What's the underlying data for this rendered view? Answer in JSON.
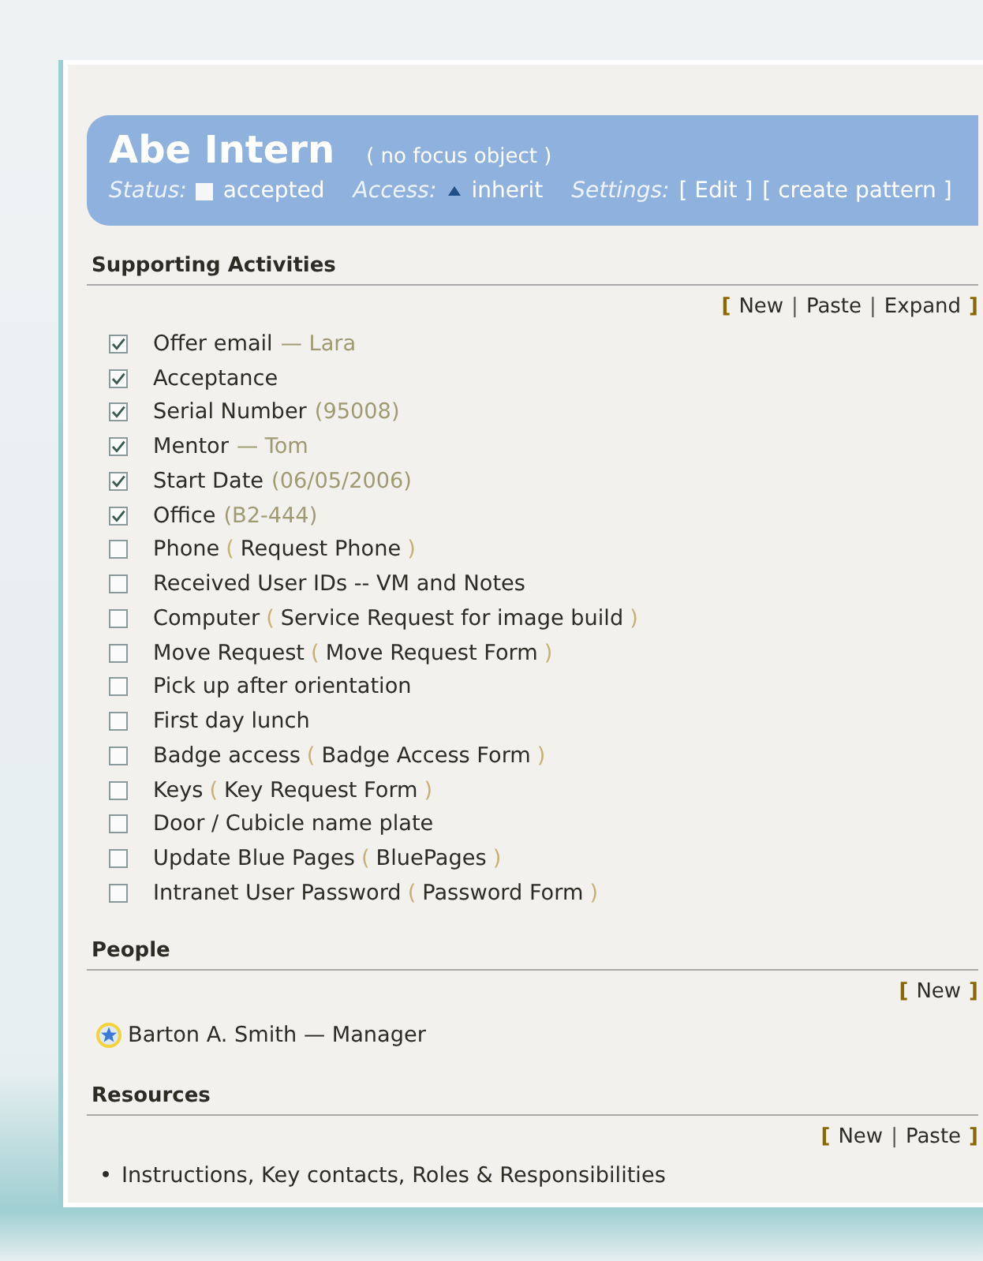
{
  "header": {
    "title": "Abe Intern",
    "focus": "( no focus object )",
    "status_label": "Status:",
    "status_value": "accepted",
    "access_label": "Access:",
    "access_value": "inherit",
    "settings_label": "Settings:",
    "settings_links": [
      "[ Edit ]",
      "[ create pattern ]"
    ]
  },
  "sections": [
    {
      "title": "Supporting Activities",
      "kind": "checklist",
      "actions": {
        "open": "[",
        "close": "]",
        "separator": "|",
        "items": [
          "New",
          "Paste",
          "Expand"
        ]
      },
      "items": [
        {
          "label": "Offer email",
          "checked": true,
          "kind": "person",
          "dash": "—",
          "detail": "Lara"
        },
        {
          "label": "Acceptance",
          "checked": true
        },
        {
          "label": "Serial Number",
          "checked": true,
          "kind": "value",
          "detail": "(95008)"
        },
        {
          "label": "Mentor",
          "checked": true,
          "kind": "person",
          "dash": "—",
          "detail": "Tom"
        },
        {
          "label": "Start Date",
          "checked": true,
          "kind": "value",
          "detail": "(06/05/2006)"
        },
        {
          "label": "Office",
          "checked": true,
          "kind": "value",
          "detail": "(B2-444)"
        },
        {
          "label": "Phone",
          "checked": false,
          "kind": "form",
          "open": "(",
          "detail": "Request Phone",
          "close": ")"
        },
        {
          "label": "Received User IDs -- VM and Notes",
          "checked": false
        },
        {
          "label": "Computer",
          "checked": false,
          "kind": "form",
          "open": "(",
          "detail": "Service Request for image build",
          "close": ")"
        },
        {
          "label": "Move Request",
          "checked": false,
          "kind": "form",
          "open": "(",
          "detail": "Move Request Form",
          "close": ")"
        },
        {
          "label": "Pick up after orientation",
          "checked": false
        },
        {
          "label": "First day lunch",
          "checked": false
        },
        {
          "label": "Badge access",
          "checked": false,
          "kind": "form",
          "open": "(",
          "detail": "Badge Access Form",
          "close": ")"
        },
        {
          "label": "Keys",
          "checked": false,
          "kind": "form",
          "open": "(",
          "detail": "Key Request Form",
          "close": ")"
        },
        {
          "label": "Door / Cubicle name plate",
          "checked": false
        },
        {
          "label": "Update Blue Pages",
          "checked": false,
          "kind": "form",
          "open": "(",
          "detail": "BluePages",
          "close": ")"
        },
        {
          "label": "Intranet User Password",
          "checked": false,
          "kind": "form",
          "open": "(",
          "detail": "Password Form",
          "close": ")"
        }
      ]
    },
    {
      "title": "People",
      "kind": "people",
      "actions": {
        "open": "[",
        "close": "]",
        "items": [
          "New"
        ]
      },
      "items": [
        {
          "label": "Barton A. Smith — Manager"
        }
      ]
    },
    {
      "title": "Resources",
      "kind": "bullets",
      "actions": {
        "open": "[",
        "close": "]",
        "separator": "|",
        "items": [
          "New",
          "Paste"
        ]
      },
      "items": [
        {
          "bullet": "•",
          "label": "Instructions, Key contacts, Roles & Responsibilities"
        }
      ]
    }
  ]
}
